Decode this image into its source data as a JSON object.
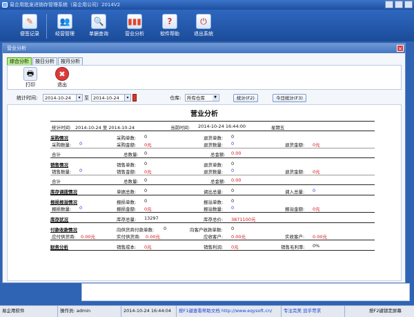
{
  "window": {
    "title": "易企用批发进销存管理系统（易企用公司）2014V2"
  },
  "toolbar": {
    "items": [
      {
        "label": "便签记录",
        "icon": "note-icon",
        "color": "#e56a2d"
      },
      {
        "label": "经营管理",
        "icon": "people-icon",
        "color": "#3a7ad6"
      },
      {
        "label": "单据查询",
        "icon": "magnifier-icon",
        "color": "#2f82c9"
      },
      {
        "label": "营业分析",
        "icon": "bar-chart-icon",
        "color": "#e1462b"
      },
      {
        "label": "软件帮助",
        "icon": "help-icon",
        "color": "#d93b3b"
      },
      {
        "label": "退出系统",
        "icon": "power-icon",
        "color": "#c81f1f"
      }
    ]
  },
  "dialog": {
    "title": "营业分析",
    "close": "×",
    "tabs": [
      "综合分析",
      "按日分析",
      "按月分析"
    ],
    "ribbon": {
      "print": "打印",
      "exit": "退出"
    },
    "filters": {
      "time_label": "统计时间:",
      "date_from": "2014-10-24",
      "to_label": "至",
      "date_to": "2014-10-24",
      "warehouse_label": "仓库:",
      "warehouse_value": "所有仓库",
      "stat_button": "统计(F2)",
      "today_button": "今日统计(F3)"
    },
    "report": {
      "title": "营业分析",
      "meta": {
        "period_label": "统计时间:",
        "period_value": "2014-10-24 至 2014-10-24",
        "now_label": "当前时间:",
        "now_value": "2014-10-24 16:44:00",
        "weekday": "星期五"
      },
      "purchase": {
        "title": "采购情况",
        "r1": [
          "采购单数:",
          "0",
          "退货单数:",
          "0"
        ],
        "r2": [
          "采购数量:",
          "0",
          "采购金额:",
          "0元",
          "退货数量:",
          "0",
          "退货金额:",
          "0元"
        ],
        "total": [
          "合计",
          "总数量:",
          "0",
          "总金额:",
          "0.00"
        ]
      },
      "sales": {
        "title": "销售情况",
        "r1": [
          "销售单数:",
          "0",
          "退货单数:",
          "0"
        ],
        "r2": [
          "销售数量:",
          "0",
          "销售金额:",
          "0元",
          "退货数量:",
          "0",
          "退货金额:",
          "0元"
        ],
        "total": [
          "合计",
          "总数量:",
          "0",
          "总金额:",
          "0.00"
        ]
      },
      "transfer": {
        "title": "库存调拨情况",
        "r1": [
          "单据总数:",
          "0",
          "调出总量:",
          "0",
          "调入总量:",
          "0"
        ]
      },
      "exchange": {
        "title": "报损报溢情况",
        "r1": [
          "报损单数:",
          "0",
          "报溢单数:",
          "0"
        ],
        "r2": [
          "报损数量:",
          "0",
          "报损金额:",
          "0元",
          "报溢数量:",
          "0",
          "报溢金额:",
          "0元"
        ]
      },
      "stock": {
        "title": "库存状况",
        "r1": [
          "库存总量:",
          "13297",
          "库存总价:",
          "3871100元"
        ]
      },
      "payments": {
        "title": "付款收款情况",
        "r1": [
          "向供货商付款单数:",
          "0",
          "向客户收款单数:",
          "0"
        ],
        "r2": [
          "应付供货商:",
          "0.00元",
          "实付供货商:",
          "0.00元",
          "应收客户:",
          "0.00元",
          "实收客户:",
          "0.00元"
        ]
      },
      "finance": {
        "title": "财务分析",
        "r1": [
          "销售成本:",
          "0元",
          "销售利润:",
          "0元",
          "销售毛利率:",
          "0%"
        ]
      }
    }
  },
  "status": {
    "software": "易企用软件",
    "operator": "操作员: admin",
    "datetime": "2014-10-24 16:44:04",
    "help": "按F1键查看帮助文档 http://www.eqysoft.cn/",
    "slogan": "专注完美 追乎苛求",
    "lock": "按F2键锁定屏幕"
  }
}
